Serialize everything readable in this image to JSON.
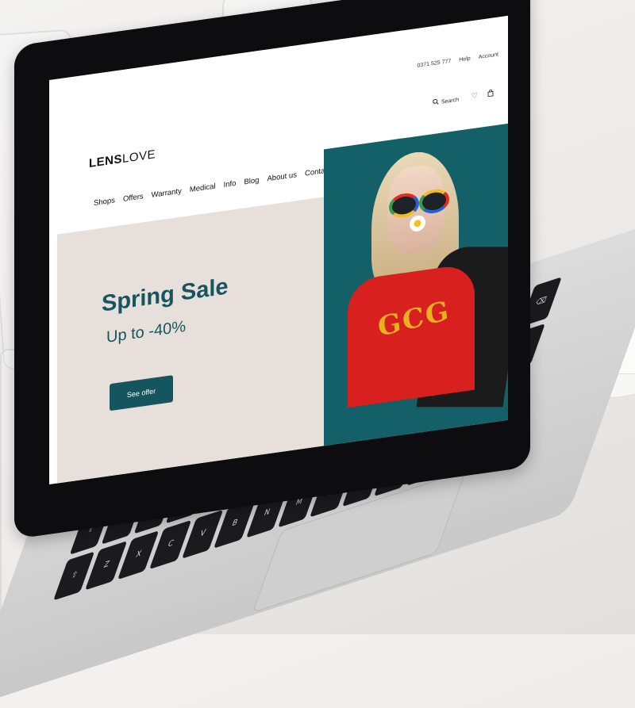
{
  "store": {
    "logo_bold": "LENS",
    "logo_light": "LOVE"
  },
  "topbar": {
    "phone": "0371 525 777",
    "help": "Help",
    "account": "Account"
  },
  "utility": {
    "search_label": "Search"
  },
  "nav": {
    "items": [
      "Shops",
      "Offers",
      "Warranty",
      "Medical",
      "Info",
      "Blog",
      "About us",
      "Contact"
    ]
  },
  "hero": {
    "title": "Spring Sale",
    "subtitle": "Up to -40%",
    "cta_label": "See offer"
  },
  "colors": {
    "accent": "#15555f",
    "hero_bg": "#e7e0da",
    "photo_bg": "#136068"
  },
  "icons": [
    "search-icon",
    "heart-icon",
    "bag-icon"
  ]
}
